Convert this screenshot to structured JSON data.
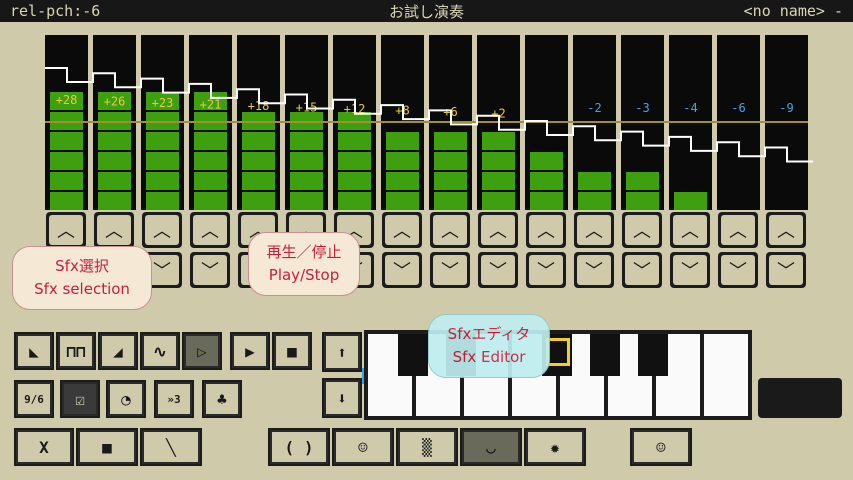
{
  "window": {
    "left": "rel-pch:-6",
    "title": "お試し演奏",
    "right": "<no name> -"
  },
  "bars": {
    "labels": [
      "+28",
      "+26",
      "+23",
      "+21",
      "+18",
      "+15",
      "+12",
      "+8",
      "+6",
      "+2",
      "",
      "-2",
      "-3",
      "-4",
      "-6",
      "-9"
    ],
    "levels": [
      0.73,
      0.77,
      0.73,
      0.69,
      0.65,
      0.59,
      0.59,
      0.51,
      0.47,
      0.45,
      0.4,
      0.3,
      0.3,
      0.18,
      0,
      0
    ],
    "colors": {
      "positive_label": "#e8c84a",
      "negative_label": "#4ca0e0",
      "bar": "#3ea00e"
    }
  },
  "toolbar": {
    "waveform_icons": [
      "sawtooth-wave-icon",
      "square-wave-icon",
      "ramp-wave-icon",
      "sine-wave-icon",
      "triangle-wave-icon"
    ],
    "play": "▶",
    "stop": "■",
    "sfx_index": "9/6",
    "tabs": [
      "( )",
      "☺",
      "▒",
      "◡",
      "✹"
    ],
    "x": "X",
    "file": "■",
    "wrench": "🔧"
  },
  "bubbles": {
    "sfx_select": [
      "Sfx選択",
      "Sfx selection"
    ],
    "play_stop": [
      "再生／停止",
      "Play/Stop"
    ],
    "sfx_editor": [
      "Sfxエディタ",
      "Sfx Editor"
    ]
  }
}
